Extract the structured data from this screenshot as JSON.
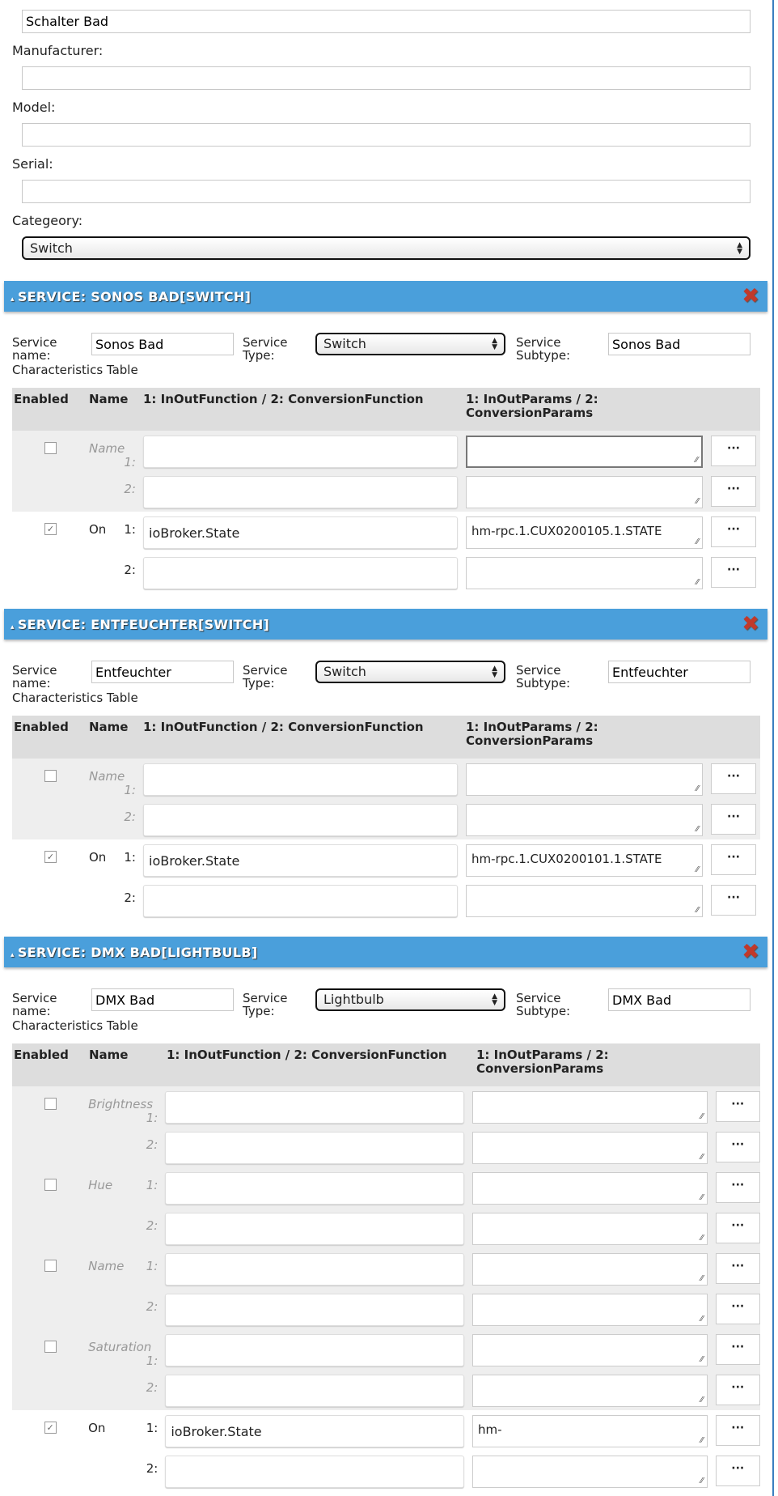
{
  "device": {
    "name_value": "Schalter Bad",
    "manufacturer_label": "Manufacturer:",
    "manufacturer_value": "",
    "model_label": "Model:",
    "model_value": "",
    "serial_label": "Serial:",
    "serial_value": "",
    "category_label": "Categeory:",
    "category_value": "Switch"
  },
  "labels": {
    "service_name": "Service name:",
    "service_type": "Service Type:",
    "service_subtype": "Service Subtype:",
    "characteristics_table": "Characteristics Table",
    "col_enabled": "Enabled",
    "col_name": "Name",
    "col_function": "1: InOutFunction / 2: ConversionFunction",
    "col_params": "1: InOutParams / 2: ConversionParams",
    "idx1": "1:",
    "idx2": "2:",
    "more_button": "···",
    "collapse_icon": "▴",
    "close_icon": "✖"
  },
  "colors": {
    "header_bar": "#4a9fdb",
    "delete": "#c0392b"
  },
  "services": [
    {
      "title": "SERVICE: SONOS BAD[SWITCH]",
      "name": "Sonos Bad",
      "type": "Switch",
      "subtype": "Sonos Bad",
      "characteristics": [
        {
          "name": "Name",
          "enabled": false,
          "function1": "",
          "params1": "",
          "function2": "",
          "params2": ""
        },
        {
          "name": "On",
          "enabled": true,
          "function1": "ioBroker.State",
          "params1": "hm-rpc.1.CUX0200105.1.STATE",
          "function2": "",
          "params2": ""
        }
      ]
    },
    {
      "title": "SERVICE: ENTFEUCHTER[SWITCH]",
      "name": "Entfeuchter",
      "type": "Switch",
      "subtype": "Entfeuchter",
      "characteristics": [
        {
          "name": "Name",
          "enabled": false,
          "function1": "",
          "params1": "",
          "function2": "",
          "params2": ""
        },
        {
          "name": "On",
          "enabled": true,
          "function1": "ioBroker.State",
          "params1": "hm-rpc.1.CUX0200101.1.STATE",
          "function2": "",
          "params2": ""
        }
      ]
    },
    {
      "title": "SERVICE: DMX BAD[LIGHTBULB]",
      "name": "DMX Bad",
      "type": "Lightbulb",
      "subtype": "DMX Bad",
      "characteristics": [
        {
          "name": "Brightness",
          "enabled": false,
          "function1": "",
          "params1": "",
          "function2": "",
          "params2": ""
        },
        {
          "name": "Hue",
          "enabled": false,
          "function1": "",
          "params1": "",
          "function2": "",
          "params2": ""
        },
        {
          "name": "Name",
          "enabled": false,
          "function1": "",
          "params1": "",
          "function2": "",
          "params2": ""
        },
        {
          "name": "Saturation",
          "enabled": false,
          "function1": "",
          "params1": "",
          "function2": "",
          "params2": ""
        },
        {
          "name": "On",
          "enabled": true,
          "function1": "ioBroker.State",
          "params1": "hm-",
          "function2": "",
          "params2": ""
        }
      ]
    }
  ]
}
